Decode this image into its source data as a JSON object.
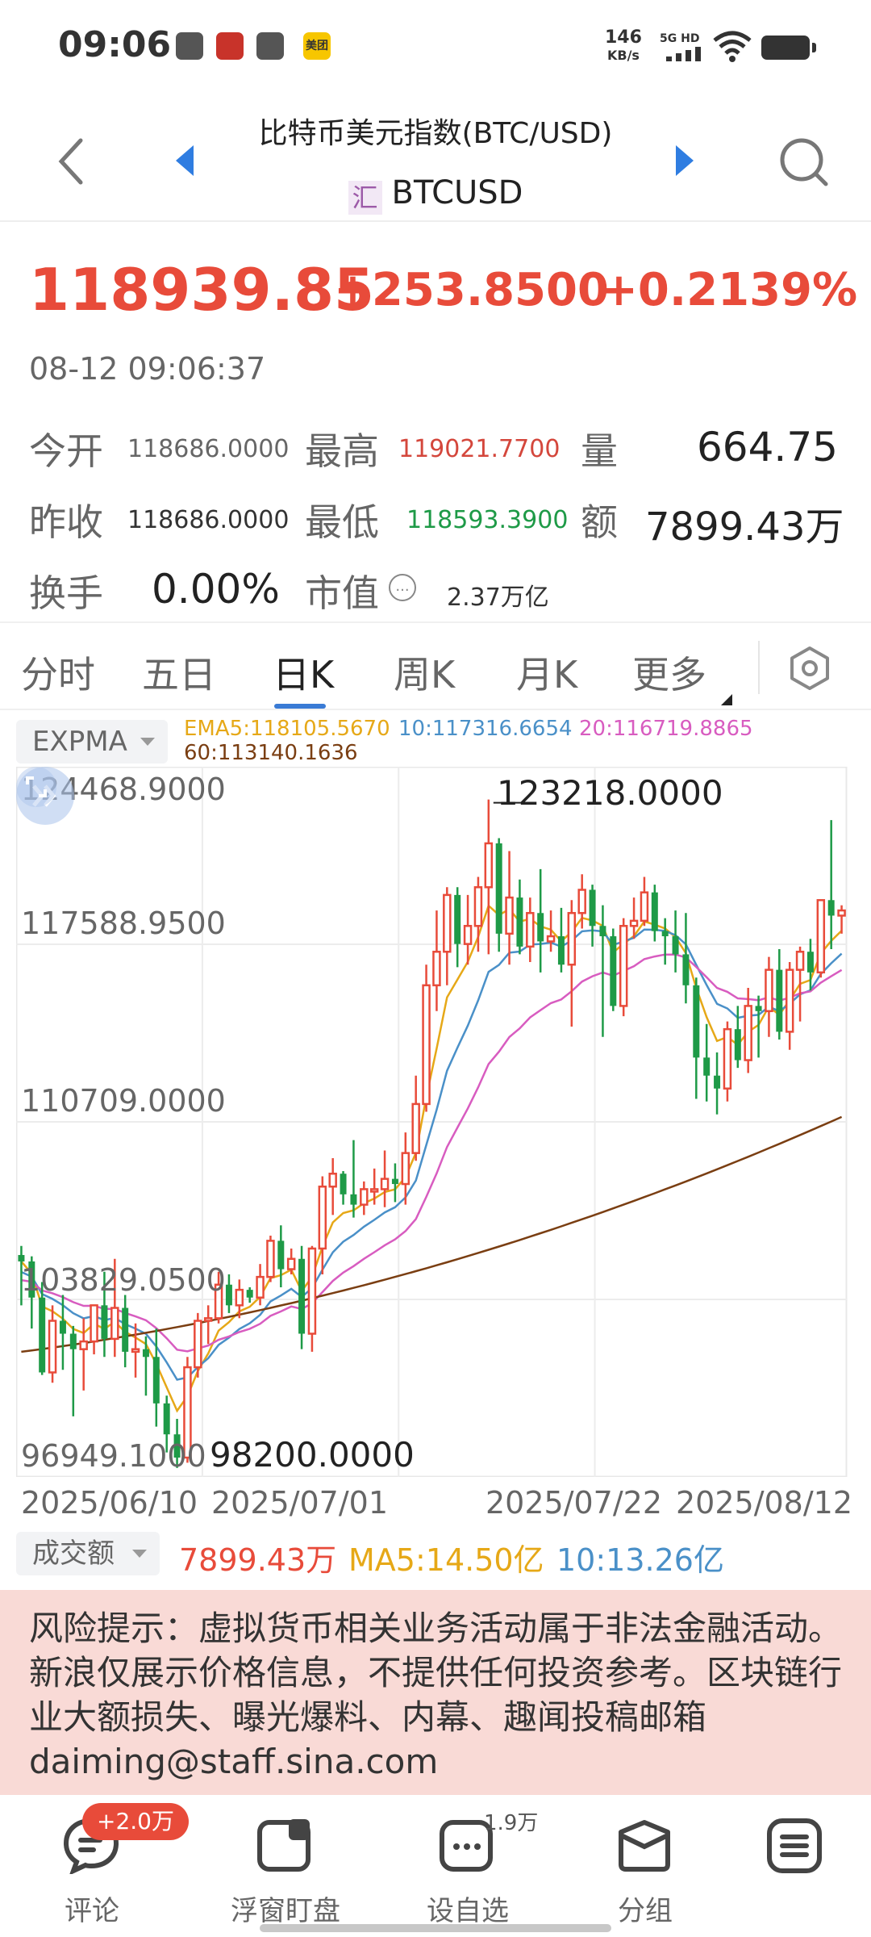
{
  "status_bar": {
    "time": "09:06",
    "net_speed_value": "146",
    "net_speed_unit": "KB/s",
    "network": "5G HD",
    "app_badge": "美团"
  },
  "header": {
    "title": "比特币美元指数(BTC/USD)",
    "symbol_icon": "汇",
    "symbol": "BTCUSD"
  },
  "quote": {
    "price": "118939.85",
    "change": "+253.8500",
    "change_pct": "+0.2139%",
    "timestamp": "08-12 09:06:37",
    "up_color": "#e84b3a",
    "down_color": "#1e9a47"
  },
  "stats": {
    "open_label": "今开",
    "open_value": "118686.0000",
    "high_label": "最高",
    "high_value": "119021.7700",
    "volume_label": "量",
    "volume_value": "664.75",
    "prev_close_label": "昨收",
    "prev_close_value": "118686.0000",
    "low_label": "最低",
    "low_value": "118593.3900",
    "amount_label": "额",
    "amount_value": "7899.43万",
    "turnover_label": "换手",
    "turnover_value": "0.00%",
    "mktcap_label": "市值",
    "mktcap_icon": "...",
    "mktcap_value": "2.37万亿"
  },
  "tabs": [
    {
      "label": "分时"
    },
    {
      "label": "五日"
    },
    {
      "label": "日K"
    },
    {
      "label": "周K"
    },
    {
      "label": "月K"
    },
    {
      "label": "更多"
    }
  ],
  "active_tab": "日K",
  "indicator": {
    "name": "EXPMA",
    "ema5": "EMA5:118105.5670",
    "ema10": "10:117316.6654",
    "ema20": "20:116719.8865",
    "ema60": "60:113140.1636",
    "colors": {
      "ema5": "#e6a817",
      "ema10": "#4a90c8",
      "ema20": "#d85cc0",
      "ema60": "#7a3e12"
    }
  },
  "chart": {
    "y_labels": [
      "124468.9000",
      "117588.9500",
      "110709.0000",
      "103829.0500",
      "96949.1000"
    ],
    "max_label": "123218.0000",
    "min_label": "98200.0000",
    "x_labels": [
      "2025/06/10",
      "2025/07/01",
      "2025/07/22",
      "2025/08/12"
    ]
  },
  "chart_data": {
    "type": "candlestick",
    "ylim": [
      96949.1,
      124468.9
    ],
    "candles": [
      [
        105550,
        105900,
        103600,
        105300
      ],
      [
        105300,
        105500,
        102700,
        103900
      ],
      [
        103900,
        104500,
        100900,
        101000
      ],
      [
        101000,
        103600,
        100600,
        103000
      ],
      [
        103000,
        104000,
        101100,
        102500
      ],
      [
        102500,
        102800,
        99300,
        101900
      ],
      [
        101900,
        103100,
        100300,
        102200
      ],
      [
        102200,
        103600,
        101700,
        103600
      ],
      [
        103600,
        104900,
        101600,
        102300
      ],
      [
        102300,
        105400,
        101600,
        103500
      ],
      [
        103500,
        104000,
        101200,
        101800
      ],
      [
        101800,
        102900,
        100800,
        101900
      ],
      [
        101900,
        102400,
        100100,
        101600
      ],
      [
        101600,
        102700,
        98900,
        99800
      ],
      [
        99800,
        100100,
        97900,
        98600
      ],
      [
        98600,
        99200,
        97300,
        97700
      ],
      [
        97700,
        101600,
        97500,
        101200
      ],
      [
        101200,
        103300,
        100800,
        103000
      ],
      [
        103000,
        103600,
        102100,
        103100
      ],
      [
        103100,
        104900,
        102900,
        104400
      ],
      [
        104400,
        104800,
        103300,
        103600
      ],
      [
        103600,
        104600,
        103100,
        104200
      ],
      [
        104200,
        104300,
        103700,
        103900
      ],
      [
        103900,
        105200,
        103600,
        104700
      ],
      [
        104700,
        106300,
        104500,
        106100
      ],
      [
        106100,
        106700,
        104300,
        105000
      ],
      [
        105000,
        105800,
        104800,
        105400
      ],
      [
        105400,
        105900,
        101900,
        102500
      ],
      [
        102500,
        105900,
        101800,
        105800
      ],
      [
        105800,
        108600,
        104800,
        108200
      ],
      [
        108200,
        109300,
        107100,
        108700
      ],
      [
        108700,
        108800,
        107500,
        107900
      ],
      [
        107900,
        110000,
        107000,
        107500
      ],
      [
        107500,
        108400,
        107100,
        108100
      ],
      [
        108100,
        108900,
        107500,
        108100
      ],
      [
        108100,
        109600,
        107400,
        108500
      ],
      [
        108500,
        109100,
        107600,
        108300
      ],
      [
        108300,
        110300,
        107500,
        109500
      ],
      [
        109500,
        112500,
        109200,
        111400
      ],
      [
        111400,
        116800,
        111100,
        116000
      ],
      [
        116000,
        118900,
        115000,
        117300
      ],
      [
        117300,
        119800,
        116000,
        119500
      ],
      [
        119500,
        119800,
        116700,
        117600
      ],
      [
        117600,
        119500,
        116800,
        118300
      ],
      [
        118300,
        120200,
        117300,
        119800
      ],
      [
        119800,
        123200,
        117200,
        121500
      ],
      [
        121500,
        121700,
        117300,
        118000
      ],
      [
        118000,
        121200,
        116800,
        119400
      ],
      [
        119400,
        120100,
        117200,
        117500
      ],
      [
        117500,
        119400,
        116900,
        118800
      ],
      [
        118800,
        120500,
        116500,
        117700
      ],
      [
        117700,
        118900,
        117300,
        117900
      ],
      [
        117900,
        119000,
        116500,
        116800
      ],
      [
        116800,
        119300,
        114400,
        118800
      ],
      [
        118800,
        120300,
        118200,
        119700
      ],
      [
        119700,
        119900,
        117500,
        118300
      ],
      [
        118300,
        119100,
        114000,
        117900
      ],
      [
        117900,
        118200,
        115000,
        115200
      ],
      [
        115200,
        118600,
        114800,
        118300
      ],
      [
        118300,
        119400,
        117800,
        118500
      ],
      [
        118500,
        120200,
        118300,
        119600
      ],
      [
        119600,
        119900,
        117700,
        118100
      ],
      [
        118100,
        118600,
        116800,
        117900
      ],
      [
        117900,
        118900,
        116500,
        117200
      ],
      [
        117200,
        118800,
        115300,
        116000
      ],
      [
        116000,
        116300,
        111600,
        113200
      ],
      [
        113200,
        114500,
        111500,
        112500
      ],
      [
        112500,
        113400,
        111000,
        112000
      ],
      [
        112000,
        114600,
        111500,
        114300
      ],
      [
        114300,
        115200,
        112800,
        113100
      ],
      [
        113100,
        115900,
        112600,
        115200
      ],
      [
        115200,
        115600,
        113200,
        115000
      ],
      [
        115000,
        117100,
        114000,
        116600
      ],
      [
        116600,
        117400,
        113900,
        114200
      ],
      [
        114200,
        116900,
        113500,
        116600
      ],
      [
        116600,
        117500,
        114600,
        117300
      ],
      [
        117300,
        117800,
        115800,
        116500
      ],
      [
        116500,
        119300,
        116300,
        119300
      ],
      [
        119300,
        122400,
        117400,
        118700
      ],
      [
        118700,
        119100,
        118000,
        118900
      ]
    ],
    "ema60_range": [
      101800,
      110900
    ],
    "x_labels": [
      "2025/06/10",
      "2025/07/01",
      "2025/07/22",
      "2025/08/12"
    ]
  },
  "volume": {
    "name": "成交额",
    "value": "7899.43万",
    "ma5": "MA5:14.50亿",
    "ma10": "10:13.26亿"
  },
  "risk_notice": "风险提示：虚拟货币相关业务活动属于非法金融活动。新浪仅展示价格信息，不提供任何投资参考。区块链行业大额损失、曝光爆料、内幕、趣闻投稿邮箱 daiming@staff.sina.com",
  "bottom_nav": {
    "items": [
      {
        "label": "评论",
        "icon": "comment-icon"
      },
      {
        "label": "浮窗盯盘",
        "icon": "float-window-icon"
      },
      {
        "label": "设自选",
        "icon": "add-watchlist-icon"
      },
      {
        "label": "分组",
        "icon": "group-icon"
      },
      {
        "label": "",
        "icon": "menu-icon"
      }
    ],
    "comment_badge": "+2.0万",
    "watch_count": "1.9万"
  }
}
